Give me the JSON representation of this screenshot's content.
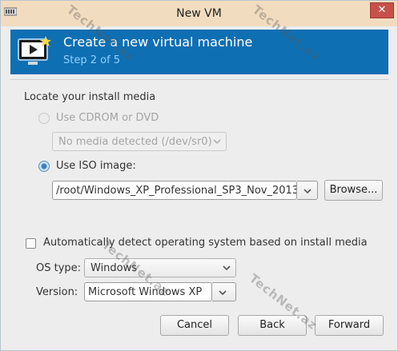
{
  "window": {
    "title": "New VM",
    "close_glyph": "✕"
  },
  "banner": {
    "heading": "Create a new virtual machine",
    "step": "Step 2 of 5",
    "icon": "vm-monitor-icon"
  },
  "install_media": {
    "section_label": "Locate your install media",
    "cdrom_option": "Use CDROM or DVD",
    "cdrom_combo_value": "No media detected (/dev/sr0)",
    "iso_option": "Use ISO image:",
    "iso_path": "/root/Windows_XP_Professional_SP3_Nov_2013",
    "browse_label": "Browse..."
  },
  "os_detect": {
    "auto_detect_label": "Automatically detect operating system based on install media",
    "os_type_label": "OS type:",
    "os_type_value": "Windows",
    "version_label": "Version:",
    "version_value": "Microsoft Windows XP"
  },
  "buttons": {
    "cancel": "Cancel",
    "back": "Back",
    "forward": "Forward"
  },
  "watermark": "TechNet.az",
  "colors": {
    "banner": "#0f6fb3",
    "titlebar": "#f2dcbf",
    "close": "#c7504b"
  }
}
